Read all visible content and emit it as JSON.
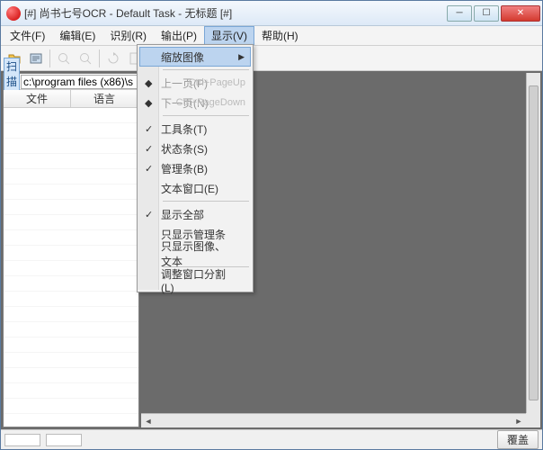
{
  "title": "[#] 尚书七号OCR - Default Task - 无标题 [#]",
  "menus": {
    "file": "文件(F)",
    "edit": "编辑(E)",
    "recognize": "识别(R)",
    "output": "输出(P)",
    "view": "显示(V)",
    "help": "帮助(H)"
  },
  "dropdown": {
    "zoom": "缩放图像",
    "prev": "上一页(P)",
    "prev_sc": "Ctrl+PageUp",
    "next": "下一页(N)",
    "next_sc": "Ctrl+PageDown",
    "toolbar": "工具条(T)",
    "statusbar": "状态条(S)",
    "manager": "管理条(B)",
    "textwin": "文本窗口(E)",
    "showall": "显示全部",
    "only_mgr": "只显示管理条",
    "only_img": "只显示图像、文本",
    "split": "调整窗口分割(L)"
  },
  "left": {
    "scan_label": "扫描到",
    "path": "c:\\program files (x86)\\s",
    "col_file": "文件",
    "col_lang": "语言"
  },
  "status": {
    "cover": "覆盖"
  }
}
